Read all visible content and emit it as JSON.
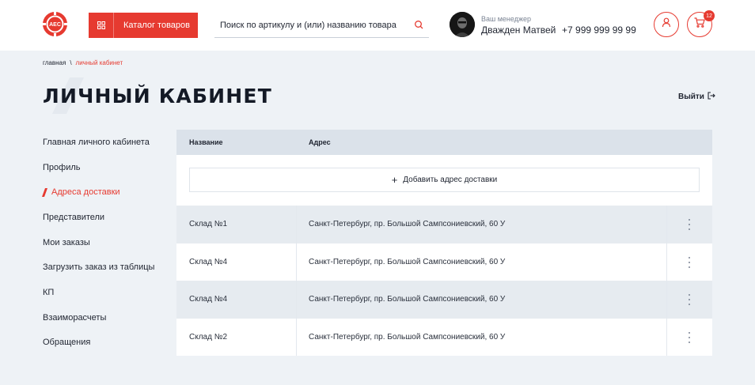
{
  "header": {
    "logo_text": "АЕС",
    "catalog_label": "Каталог товаров",
    "search_placeholder": "Поиск по артикулу и (или) названию товара",
    "manager_caption": "Ваш менеджер",
    "manager_name": "Дважден Матвей",
    "manager_phone": "+7 999 999 99 99",
    "cart_count": "12",
    "icons": [
      "logo-icon",
      "grid-icon",
      "search-icon",
      "user-icon",
      "cart-icon"
    ]
  },
  "breadcrumb": {
    "home": "главная",
    "separator": "\\",
    "current": "личный кабинет"
  },
  "page": {
    "title": "ЛИЧНЫЙ КАБИНЕТ",
    "logout_label": "Выйти"
  },
  "sidebar": {
    "items": [
      {
        "label": "Главная личного кабинета",
        "active": false
      },
      {
        "label": "Профиль",
        "active": false
      },
      {
        "label": "Адреса доставки",
        "active": true
      },
      {
        "label": "Представители",
        "active": false
      },
      {
        "label": "Мои заказы",
        "active": false
      },
      {
        "label": "Загрузить заказ из таблицы",
        "active": false
      },
      {
        "label": "КП",
        "active": false
      },
      {
        "label": "Взаиморасчеты",
        "active": false
      },
      {
        "label": "Обращения",
        "active": false
      }
    ]
  },
  "table": {
    "col_name": "Название",
    "col_address": "Адрес",
    "add_label": "Добавить адрес доставки",
    "rows": [
      {
        "name": "Склад №1",
        "address": "Санкт-Петербург, пр. Большой Сампсониевский, 60 У"
      },
      {
        "name": "Склад №4",
        "address": "Санкт-Петербург, пр. Большой Сампсониевский, 60 У"
      },
      {
        "name": "Склад №4",
        "address": "Санкт-Петербург, пр. Большой Сампсониевский, 60 У"
      },
      {
        "name": "Склад №2",
        "address": "Санкт-Петербург, пр. Большой Сампсониевский, 60 У"
      }
    ]
  },
  "colors": {
    "accent": "#e63a30",
    "background": "#eef2f6",
    "table_header": "#dbe2ea",
    "row_alt": "#e6ebf0"
  }
}
